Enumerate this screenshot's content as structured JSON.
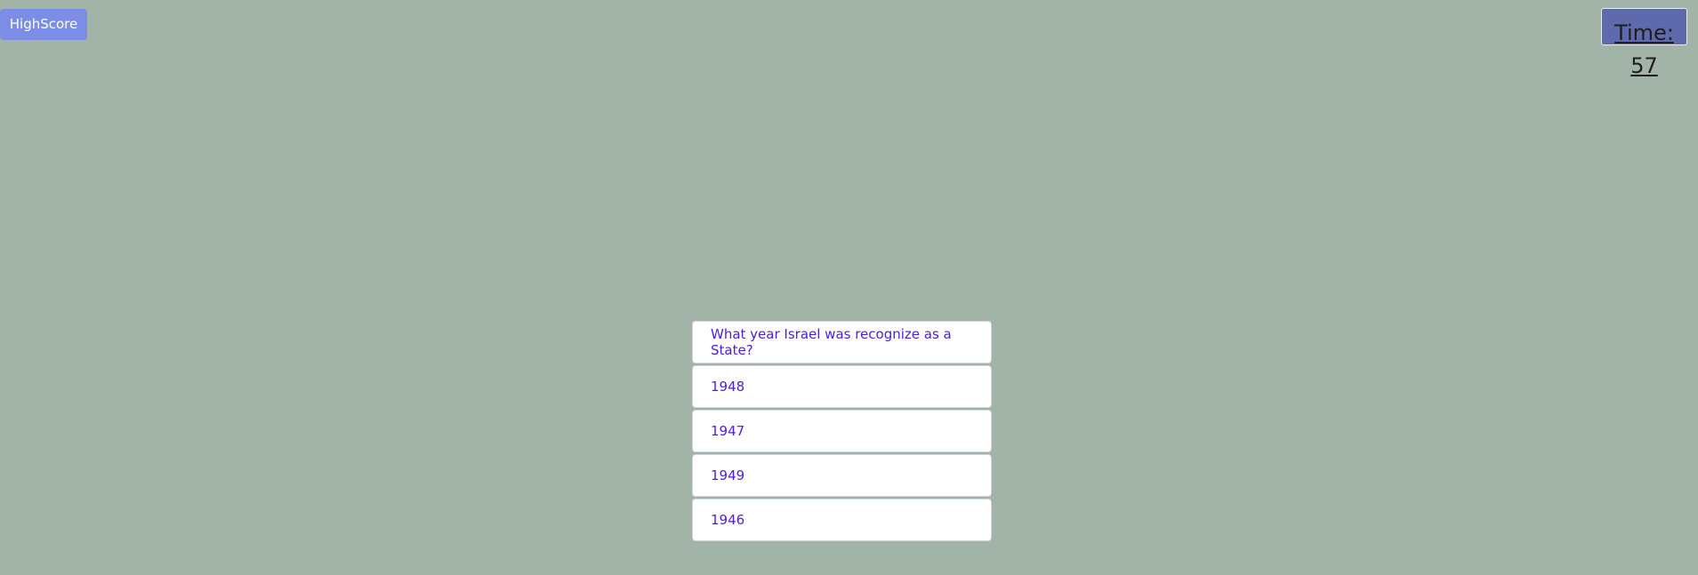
{
  "header": {
    "highscore_label": "HighScore",
    "timer_label": "Time:",
    "timer_value": "57"
  },
  "quiz": {
    "question": "What year Israel was recognize as a State?",
    "answers": [
      "1948",
      "1947",
      "1949",
      "1946"
    ]
  },
  "colors": {
    "background": "#a2b4a8",
    "highscore_button": "#7b8de6",
    "timer_box": "#5e6aab",
    "text_accent": "#4f1ce8"
  }
}
